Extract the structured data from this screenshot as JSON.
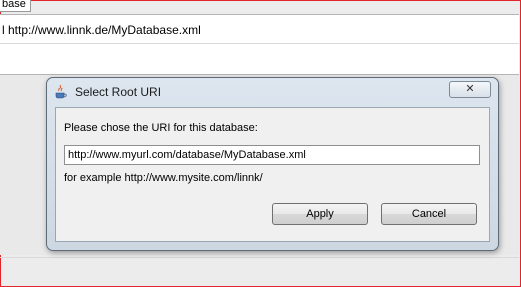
{
  "window": {
    "tab_label": "base",
    "url_text": "l http://www.linnk.de/MyDatabase.xml"
  },
  "dialog": {
    "title": "Select Root URI",
    "close_label": "✕",
    "prompt": "Please chose the URI for this database:",
    "uri_value": "http://www.myurl.com/database/MyDatabase.xml",
    "example": "for example http://www.mysite.com/linnk/",
    "apply_label": "Apply",
    "cancel_label": "Cancel"
  },
  "colors": {
    "frame": "#e0262a",
    "dialog_border": "#5e6b78",
    "titlebar": "#dde6ef"
  }
}
